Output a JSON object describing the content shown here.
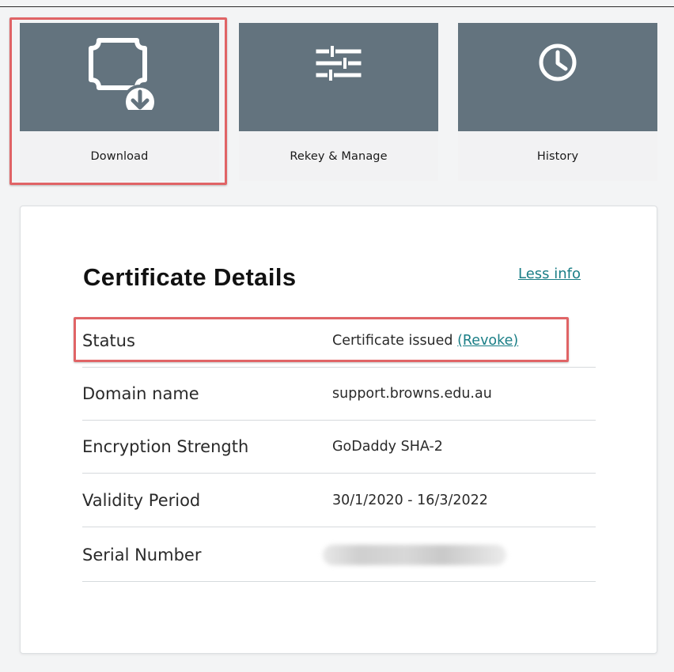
{
  "tiles": {
    "download": {
      "label": "Download",
      "icon": "certificate-download-icon"
    },
    "rekey": {
      "label": "Rekey & Manage",
      "icon": "sliders-icon"
    },
    "history": {
      "label": "History",
      "icon": "clock-icon"
    }
  },
  "details": {
    "title": "Certificate Details",
    "toggle_label": "Less info",
    "rows": [
      {
        "label": "Status",
        "value": "Certificate issued",
        "action": "(Revoke)"
      },
      {
        "label": "Domain name",
        "value": "support.browns.edu.au"
      },
      {
        "label": "Encryption Strength",
        "value": "GoDaddy SHA-2"
      },
      {
        "label": "Validity Period",
        "value": "30/1/2020 - 16/3/2022"
      },
      {
        "label": "Serial Number",
        "value": ""
      }
    ]
  },
  "colors": {
    "tile_header": "#63737e",
    "link": "#1a7e86",
    "highlight": "#e06466"
  }
}
